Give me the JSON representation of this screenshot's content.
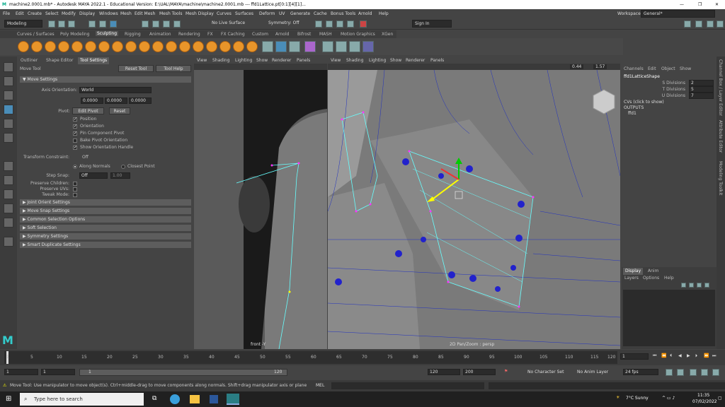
{
  "titlebar": {
    "title": "machine2.0001.mb* - Autodesk MAYA 2022.1 - Educational Version: E:\\UAL\\MAYA\\machine\\machine2.0001.mb    ---    ffd1Lattice.pt[0:1][4][1]..."
  },
  "menu": [
    "File",
    "Edit",
    "Create",
    "Select",
    "Modify",
    "Display",
    "Windows",
    "Mesh",
    "Edit Mesh",
    "Mesh Tools",
    "Mesh Display",
    "Curves",
    "Surfaces",
    "Deform",
    "UV",
    "Generate",
    "Cache",
    "Bonus Tools",
    "Arnold",
    "Help"
  ],
  "workspace": {
    "label": "Workspace:",
    "value": "General*"
  },
  "statusline": {
    "mode": "Modeling",
    "live": "No Live Surface",
    "symmetry": "Symmetry: Off",
    "signin": "Sign In"
  },
  "shelf_tabs": [
    "Curves / Surfaces",
    "Poly Modeling",
    "Sculpting",
    "Rigging",
    "Animation",
    "Rendering",
    "FX",
    "FX Caching",
    "Custom",
    "Arnold",
    "Bifrost",
    "MASH",
    "Motion Graphics",
    "XGen"
  ],
  "active_shelf": "Sculpting",
  "toolsettings": {
    "tabs": [
      "Outliner",
      "Shape Editor",
      "Tool Settings"
    ],
    "tool_name": "Move Tool",
    "reset": "Reset Tool",
    "help": "Tool Help",
    "move_settings": "Move Settings",
    "axis_label": "Axis Orientation:",
    "axis_value": "World",
    "xyz": [
      "0.0000",
      "0.0000",
      "0.0000"
    ],
    "pivot_label": "Pivot:",
    "edit_pivot": "Edit Pivot",
    "reset_pivot": "Reset",
    "checks": [
      {
        "label": "Position",
        "on": true
      },
      {
        "label": "Orientation",
        "on": true
      },
      {
        "label": "Pin Component Pivot",
        "on": true
      },
      {
        "label": "Bake Pivot Orientation",
        "on": false
      },
      {
        "label": "Show Orientation Handle",
        "on": true
      }
    ],
    "transform_constraint": "Transform Constraint:",
    "tc_value": "Off",
    "along_normals": "Along Normals",
    "closest_point": "Closest Point",
    "step_snap": "Step Snap:",
    "step_value": "Off",
    "step_num": "1.00",
    "preserve_children": "Preserve Children:",
    "preserve_uvs": "Preserve UVs:",
    "tweak_mode": "Tweak Mode:",
    "sections": [
      "Joint Orient Settings",
      "Move Snap Settings",
      "Common Selection Options",
      "Soft Selection",
      "Symmetry Settings",
      "Smart Duplicate Settings"
    ]
  },
  "viewport_menu": [
    "View",
    "Shading",
    "Lighting",
    "Show",
    "Renderer",
    "Panels"
  ],
  "vp1_label": "front -Y",
  "vp2_label": "2D Pan/Zoom : persp",
  "vp2_fields": [
    "0.44",
    "1.57"
  ],
  "channelbox": {
    "tabs": [
      "Channels",
      "Edit",
      "Object",
      "Show"
    ],
    "node": "ffd1LatticeShape",
    "attrs": [
      {
        "name": "S Divisions",
        "value": "2"
      },
      {
        "name": "T Divisions",
        "value": "5"
      },
      {
        "name": "U Divisions",
        "value": "7"
      }
    ],
    "cvs": "CVs (click to show)",
    "outputs": "OUTPUTS",
    "ffd": "ffd1"
  },
  "layer": {
    "tabs": [
      "Display",
      "Anim"
    ],
    "menu": [
      "Layers",
      "Options",
      "Help"
    ]
  },
  "side_tabs": [
    "Channel Box / Layer Editor",
    "Attribute Editor",
    "Modeling Toolkit"
  ],
  "timeline": {
    "ticks": [
      "1",
      "5",
      "10",
      "15",
      "20",
      "25",
      "30",
      "35",
      "40",
      "45",
      "50",
      "55",
      "60",
      "65",
      "70",
      "75",
      "80",
      "85",
      "90",
      "95",
      "100",
      "105",
      "110",
      "115",
      "120"
    ],
    "current": "1"
  },
  "range": {
    "start": "1",
    "start2": "1",
    "slider_start": "1",
    "slider_end": "120",
    "end1": "120",
    "end2": "200",
    "char_set": "No Character Set",
    "anim_layer": "No Anim Layer",
    "fps": "24 fps"
  },
  "help": {
    "text": "Move Tool: Use manipulator to move object(s). Ctrl+middle-drag to move components along normals. Shift+drag manipulator axis or plane handles to extrude components or c",
    "mel": "MEL"
  },
  "taskbar": {
    "search": "Type here to search",
    "weather": "7°C  Sunny",
    "time": "11:35",
    "date": "07/02/2022"
  }
}
